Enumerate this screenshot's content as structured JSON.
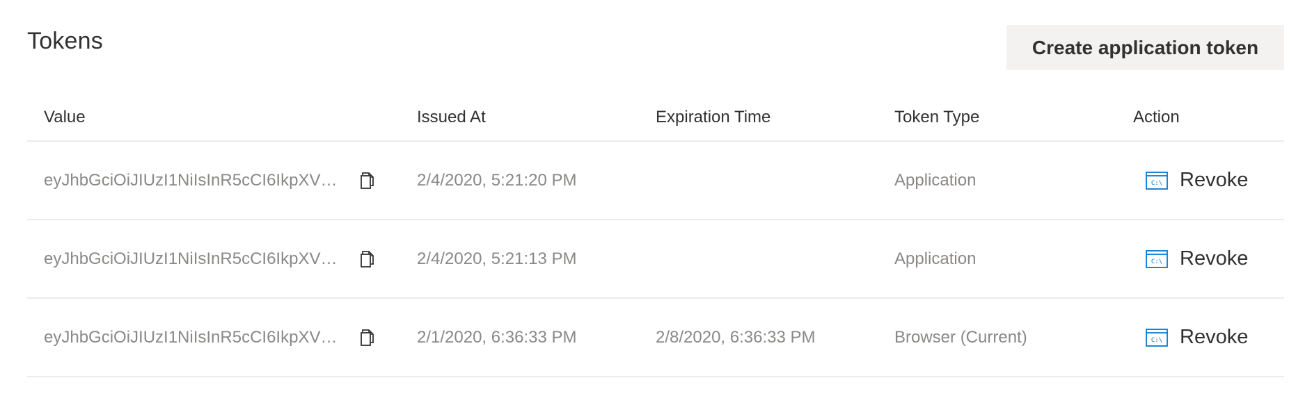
{
  "page": {
    "title": "Tokens",
    "create_button_label": "Create application token"
  },
  "table": {
    "columns": [
      "Value",
      "Issued At",
      "Expiration Time",
      "Token Type",
      "Action"
    ],
    "rows": [
      {
        "value": "eyJhbGciOiJIUzI1NiIsInR5cCI6IkpXVCJ9...",
        "issued_at": "2/4/2020, 5:21:20 PM",
        "expiration_time": "",
        "token_type": "Application",
        "action_label": "Revoke"
      },
      {
        "value": "eyJhbGciOiJIUzI1NiIsInR5cCI6IkpXVCJ9...",
        "issued_at": "2/4/2020, 5:21:13 PM",
        "expiration_time": "",
        "token_type": "Application",
        "action_label": "Revoke"
      },
      {
        "value": "eyJhbGciOiJIUzI1NiIsInR5cCI6IkpXVCJ9...",
        "issued_at": "2/1/2020, 6:36:33 PM",
        "expiration_time": "2/8/2020, 6:36:33 PM",
        "token_type": "Browser (Current)",
        "action_label": "Revoke"
      }
    ]
  },
  "icons": {
    "copy": "copy-icon",
    "revoke": "command-prompt-icon",
    "revoke_icon_text": "C:\\"
  },
  "colors": {
    "accent": "#0078d4",
    "button_bg": "#f3f2f1",
    "muted_text": "#8a8886",
    "divider": "#edebe9"
  }
}
